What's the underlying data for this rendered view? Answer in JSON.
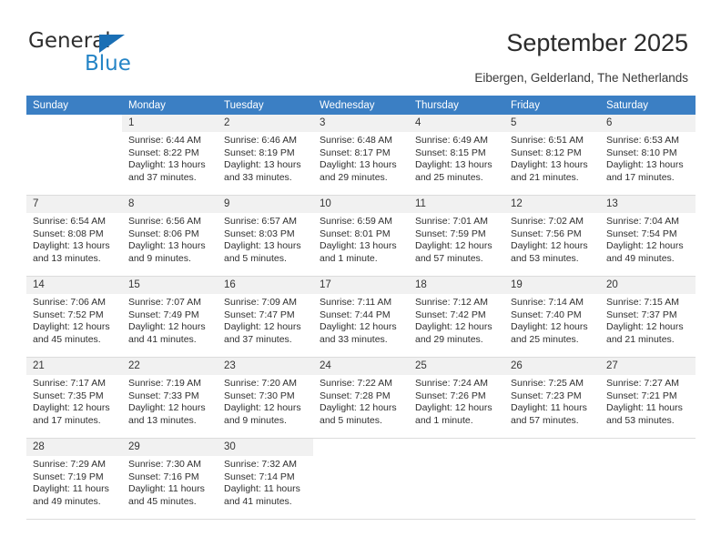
{
  "brand": {
    "name_top": "General",
    "name_bottom": "Blue",
    "triangle_color": "#1a6fb5",
    "blue_text_color": "#2484c6"
  },
  "header": {
    "title": "September 2025",
    "subtitle": "Eibergen, Gelderland, The Netherlands"
  },
  "theme": {
    "header_row_bg": "#3b7fc4",
    "header_row_text": "#ffffff",
    "daynum_bg": "#f1f1f1",
    "grid_line": "#dcdcdc"
  },
  "labels": {
    "sunrise": "Sunrise:",
    "sunset": "Sunset:",
    "daylight": "Daylight:"
  },
  "weekdays": [
    "Sunday",
    "Monday",
    "Tuesday",
    "Wednesday",
    "Thursday",
    "Friday",
    "Saturday"
  ],
  "weeks": [
    [
      {
        "blank": true
      },
      {
        "day": "1",
        "sunrise": "Sunrise: 6:44 AM",
        "sunset": "Sunset: 8:22 PM",
        "daylight1": "Daylight: 13 hours",
        "daylight2": "and 37 minutes."
      },
      {
        "day": "2",
        "sunrise": "Sunrise: 6:46 AM",
        "sunset": "Sunset: 8:19 PM",
        "daylight1": "Daylight: 13 hours",
        "daylight2": "and 33 minutes."
      },
      {
        "day": "3",
        "sunrise": "Sunrise: 6:48 AM",
        "sunset": "Sunset: 8:17 PM",
        "daylight1": "Daylight: 13 hours",
        "daylight2": "and 29 minutes."
      },
      {
        "day": "4",
        "sunrise": "Sunrise: 6:49 AM",
        "sunset": "Sunset: 8:15 PM",
        "daylight1": "Daylight: 13 hours",
        "daylight2": "and 25 minutes."
      },
      {
        "day": "5",
        "sunrise": "Sunrise: 6:51 AM",
        "sunset": "Sunset: 8:12 PM",
        "daylight1": "Daylight: 13 hours",
        "daylight2": "and 21 minutes."
      },
      {
        "day": "6",
        "sunrise": "Sunrise: 6:53 AM",
        "sunset": "Sunset: 8:10 PM",
        "daylight1": "Daylight: 13 hours",
        "daylight2": "and 17 minutes."
      }
    ],
    [
      {
        "day": "7",
        "sunrise": "Sunrise: 6:54 AM",
        "sunset": "Sunset: 8:08 PM",
        "daylight1": "Daylight: 13 hours",
        "daylight2": "and 13 minutes."
      },
      {
        "day": "8",
        "sunrise": "Sunrise: 6:56 AM",
        "sunset": "Sunset: 8:06 PM",
        "daylight1": "Daylight: 13 hours",
        "daylight2": "and 9 minutes."
      },
      {
        "day": "9",
        "sunrise": "Sunrise: 6:57 AM",
        "sunset": "Sunset: 8:03 PM",
        "daylight1": "Daylight: 13 hours",
        "daylight2": "and 5 minutes."
      },
      {
        "day": "10",
        "sunrise": "Sunrise: 6:59 AM",
        "sunset": "Sunset: 8:01 PM",
        "daylight1": "Daylight: 13 hours",
        "daylight2": "and 1 minute."
      },
      {
        "day": "11",
        "sunrise": "Sunrise: 7:01 AM",
        "sunset": "Sunset: 7:59 PM",
        "daylight1": "Daylight: 12 hours",
        "daylight2": "and 57 minutes."
      },
      {
        "day": "12",
        "sunrise": "Sunrise: 7:02 AM",
        "sunset": "Sunset: 7:56 PM",
        "daylight1": "Daylight: 12 hours",
        "daylight2": "and 53 minutes."
      },
      {
        "day": "13",
        "sunrise": "Sunrise: 7:04 AM",
        "sunset": "Sunset: 7:54 PM",
        "daylight1": "Daylight: 12 hours",
        "daylight2": "and 49 minutes."
      }
    ],
    [
      {
        "day": "14",
        "sunrise": "Sunrise: 7:06 AM",
        "sunset": "Sunset: 7:52 PM",
        "daylight1": "Daylight: 12 hours",
        "daylight2": "and 45 minutes."
      },
      {
        "day": "15",
        "sunrise": "Sunrise: 7:07 AM",
        "sunset": "Sunset: 7:49 PM",
        "daylight1": "Daylight: 12 hours",
        "daylight2": "and 41 minutes."
      },
      {
        "day": "16",
        "sunrise": "Sunrise: 7:09 AM",
        "sunset": "Sunset: 7:47 PM",
        "daylight1": "Daylight: 12 hours",
        "daylight2": "and 37 minutes."
      },
      {
        "day": "17",
        "sunrise": "Sunrise: 7:11 AM",
        "sunset": "Sunset: 7:44 PM",
        "daylight1": "Daylight: 12 hours",
        "daylight2": "and 33 minutes."
      },
      {
        "day": "18",
        "sunrise": "Sunrise: 7:12 AM",
        "sunset": "Sunset: 7:42 PM",
        "daylight1": "Daylight: 12 hours",
        "daylight2": "and 29 minutes."
      },
      {
        "day": "19",
        "sunrise": "Sunrise: 7:14 AM",
        "sunset": "Sunset: 7:40 PM",
        "daylight1": "Daylight: 12 hours",
        "daylight2": "and 25 minutes."
      },
      {
        "day": "20",
        "sunrise": "Sunrise: 7:15 AM",
        "sunset": "Sunset: 7:37 PM",
        "daylight1": "Daylight: 12 hours",
        "daylight2": "and 21 minutes."
      }
    ],
    [
      {
        "day": "21",
        "sunrise": "Sunrise: 7:17 AM",
        "sunset": "Sunset: 7:35 PM",
        "daylight1": "Daylight: 12 hours",
        "daylight2": "and 17 minutes."
      },
      {
        "day": "22",
        "sunrise": "Sunrise: 7:19 AM",
        "sunset": "Sunset: 7:33 PM",
        "daylight1": "Daylight: 12 hours",
        "daylight2": "and 13 minutes."
      },
      {
        "day": "23",
        "sunrise": "Sunrise: 7:20 AM",
        "sunset": "Sunset: 7:30 PM",
        "daylight1": "Daylight: 12 hours",
        "daylight2": "and 9 minutes."
      },
      {
        "day": "24",
        "sunrise": "Sunrise: 7:22 AM",
        "sunset": "Sunset: 7:28 PM",
        "daylight1": "Daylight: 12 hours",
        "daylight2": "and 5 minutes."
      },
      {
        "day": "25",
        "sunrise": "Sunrise: 7:24 AM",
        "sunset": "Sunset: 7:26 PM",
        "daylight1": "Daylight: 12 hours",
        "daylight2": "and 1 minute."
      },
      {
        "day": "26",
        "sunrise": "Sunrise: 7:25 AM",
        "sunset": "Sunset: 7:23 PM",
        "daylight1": "Daylight: 11 hours",
        "daylight2": "and 57 minutes."
      },
      {
        "day": "27",
        "sunrise": "Sunrise: 7:27 AM",
        "sunset": "Sunset: 7:21 PM",
        "daylight1": "Daylight: 11 hours",
        "daylight2": "and 53 minutes."
      }
    ],
    [
      {
        "day": "28",
        "sunrise": "Sunrise: 7:29 AM",
        "sunset": "Sunset: 7:19 PM",
        "daylight1": "Daylight: 11 hours",
        "daylight2": "and 49 minutes."
      },
      {
        "day": "29",
        "sunrise": "Sunrise: 7:30 AM",
        "sunset": "Sunset: 7:16 PM",
        "daylight1": "Daylight: 11 hours",
        "daylight2": "and 45 minutes."
      },
      {
        "day": "30",
        "sunrise": "Sunrise: 7:32 AM",
        "sunset": "Sunset: 7:14 PM",
        "daylight1": "Daylight: 11 hours",
        "daylight2": "and 41 minutes."
      },
      {
        "blank": true
      },
      {
        "blank": true
      },
      {
        "blank": true
      },
      {
        "blank": true
      }
    ]
  ]
}
